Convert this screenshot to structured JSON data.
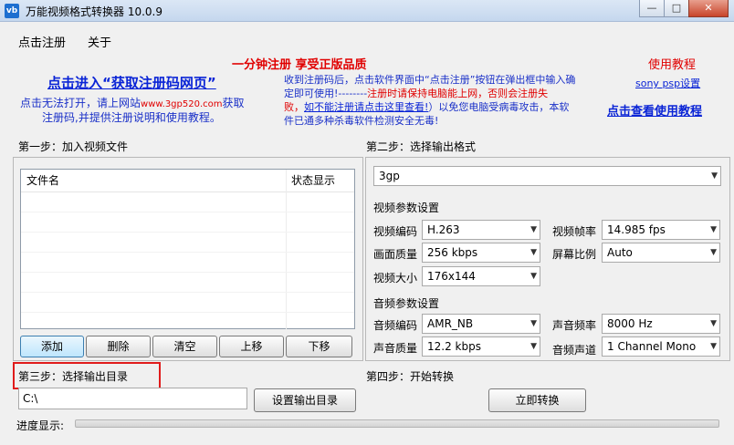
{
  "window": {
    "title": "万能视频格式转换器 10.0.9",
    "icon_label": "vb"
  },
  "menu": {
    "register": "点击注册",
    "about": "关于"
  },
  "promo": {
    "headline": "一分钟注册  享受正版品质",
    "get_code_link": "点击进入“获取注册码网页”",
    "cannot_open_1": "点击无法打开，请上网站",
    "site": "www.3gp520.com",
    "cannot_open_2": "获取",
    "cannot_open_3": "注册码,并提供注册说明和使用教程。",
    "info_line1": "收到注册码后，点击软件界面中“点击注册”按钮在弹出框中输入确",
    "info_line2": "定即可使用!--------",
    "info_red1": "注册时请保持电脑能上网，否则会注册失",
    "info_red2": "败，",
    "info_link": "如不能注册请点击这里查看!",
    "info_line3": "）以免您电脑受病毒攻击，本软",
    "info_line4": "件已通多种杀毒软件检测安全无毒!",
    "tutorial_title": "使用教程",
    "psp_link": "sony psp设置",
    "tutorial_link": "点击查看使用教程"
  },
  "step1": {
    "label": "第一步：加入视频文件",
    "columns": [
      "文件名",
      "状态显示"
    ],
    "buttons": {
      "add": "添加",
      "delete": "删除",
      "clear": "清空",
      "up": "上移",
      "down": "下移"
    }
  },
  "step2": {
    "label": "第二步：选择输出格式",
    "format": "3gp",
    "video_section": "视频参数设置",
    "video_codec_label": "视频编码",
    "video_codec": "H.263",
    "frame_rate_label": "视频帧率",
    "frame_rate": "14.985 fps",
    "quality_label": "画面质量",
    "quality": "256 kbps",
    "aspect_label": "屏幕比例",
    "aspect": "Auto",
    "size_label": "视频大小",
    "size": "176x144",
    "audio_section": "音频参数设置",
    "audio_codec_label": "音频编码",
    "audio_codec": "AMR_NB",
    "sample_rate_label": "声音频率",
    "sample_rate": "8000 Hz",
    "audio_quality_label": "声音质量",
    "audio_quality": "12.2 kbps",
    "channel_label": "音频声道",
    "channel": "1 Channel Mono"
  },
  "step3": {
    "label": "第三步：选择输出目录",
    "path": "C:\\",
    "set_button": "设置输出目录"
  },
  "step4": {
    "label": "第四步：开始转换",
    "convert_button": "立即转换"
  },
  "progress": {
    "label": "进度显示:",
    "value": 0
  },
  "colors": {
    "link_blue": "#0a24d6",
    "alert_red": "#e00000",
    "highlight": "#e01b1b"
  }
}
